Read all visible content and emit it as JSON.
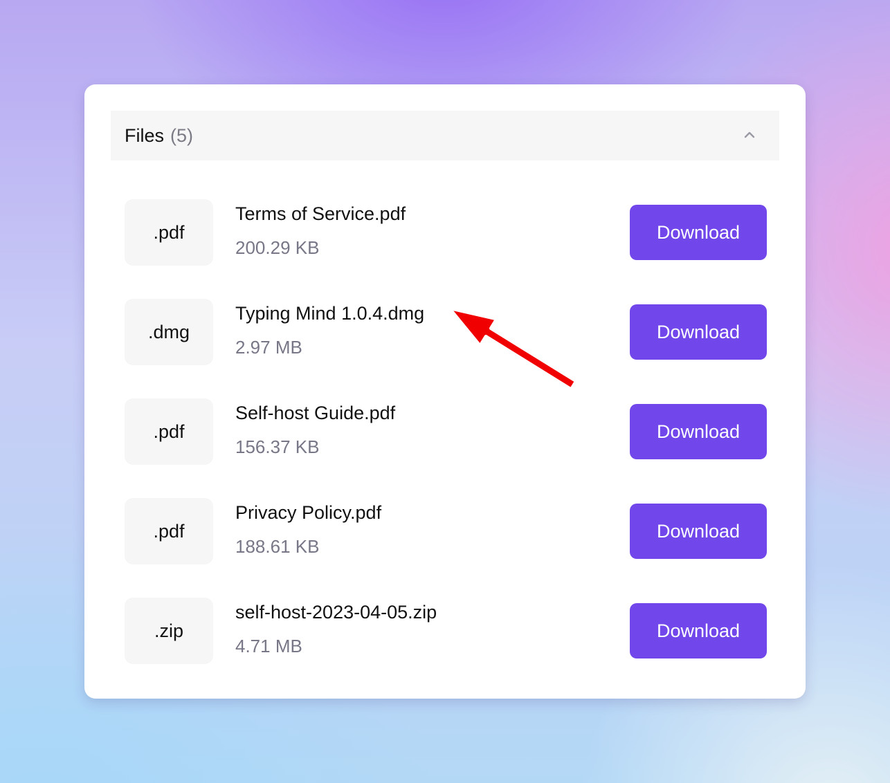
{
  "header": {
    "title": "Files",
    "count": "(5)"
  },
  "files": [
    {
      "ext": ".pdf",
      "name": "Terms of Service.pdf",
      "size": "200.29 KB",
      "button": "Download"
    },
    {
      "ext": ".dmg",
      "name": "Typing Mind 1.0.4.dmg",
      "size": "2.97 MB",
      "button": "Download"
    },
    {
      "ext": ".pdf",
      "name": "Self-host Guide.pdf",
      "size": "156.37 KB",
      "button": "Download"
    },
    {
      "ext": ".pdf",
      "name": "Privacy Policy.pdf",
      "size": "188.61 KB",
      "button": "Download"
    },
    {
      "ext": ".zip",
      "name": "self-host-2023-04-05.zip",
      "size": "4.71 MB",
      "button": "Download"
    }
  ],
  "icons": {
    "collapse": "chevron-up-icon",
    "annotation": "red-arrow-icon"
  },
  "colors": {
    "accent": "#7146ea",
    "annotation": "#f00000"
  }
}
